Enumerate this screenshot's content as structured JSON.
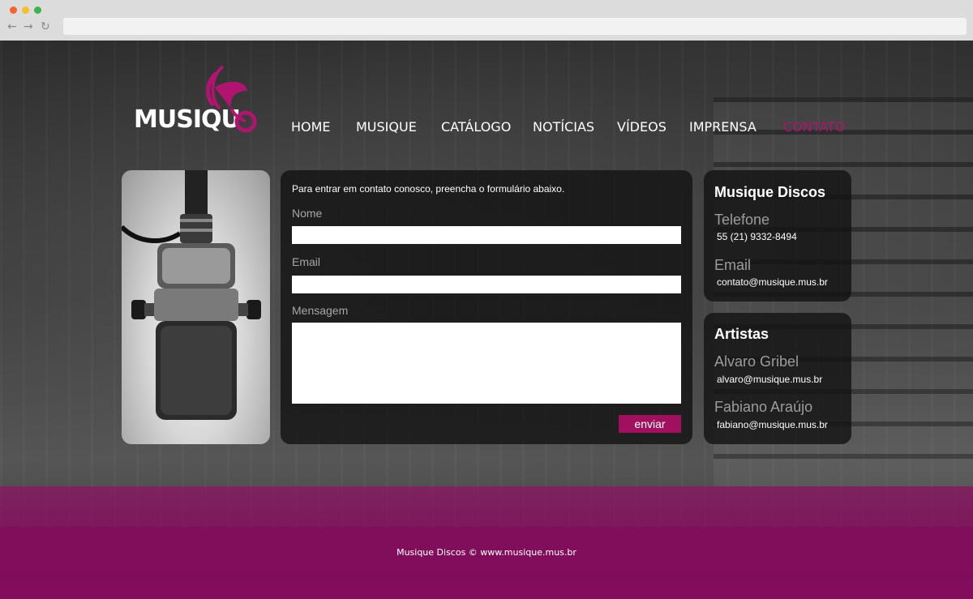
{
  "browser": {
    "back_icon": "arrow-left-icon",
    "forward_icon": "arrow-right-icon",
    "reload_icon": "reload-icon",
    "back_glyph": "←",
    "forward_glyph": "→",
    "reload_glyph": "↻"
  },
  "logo": {
    "text": "MUSIQU"
  },
  "nav": {
    "items": [
      {
        "label": "HOME"
      },
      {
        "label": "MUSIQUE"
      },
      {
        "label": "CATÁLOGO"
      },
      {
        "label": "NOTÍCIAS"
      },
      {
        "label": "VÍDEOS"
      },
      {
        "label": "IMPRENSA"
      },
      {
        "label": "CONTATO",
        "active": true
      }
    ]
  },
  "form": {
    "intro": "Para entrar em contato conosco, preencha o formulário abaixo.",
    "name_label": "Nome",
    "name_value": "",
    "email_label": "Email",
    "email_value": "",
    "message_label": "Mensagem",
    "message_value": "",
    "submit_label": "enviar"
  },
  "company": {
    "title": "Musique Discos",
    "phone_label": "Telefone",
    "phone": "55 (21) 9332-8494",
    "email_label": "Email",
    "email": "contato@musique.mus.br"
  },
  "artists": {
    "title": "Artistas",
    "items": [
      {
        "name": "Alvaro Gribel",
        "email": "alvaro@musique.mus.br"
      },
      {
        "name": "Fabiano Araújo",
        "email": "fabiano@musique.mus.br"
      }
    ]
  },
  "footer": {
    "text": "Musique Discos © www.musique.mus.br"
  },
  "colors": {
    "accent": "#a0105f",
    "nav_active": "#b0146f",
    "footer": "#8a0f63"
  }
}
